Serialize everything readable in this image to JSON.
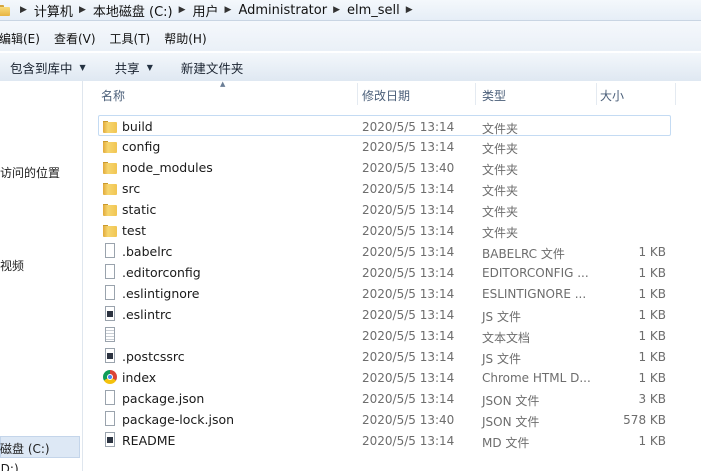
{
  "address": {
    "crumbs": [
      "计算机",
      "本地磁盘 (C:)",
      "用户",
      "Administrator",
      "elm_sell"
    ]
  },
  "menu": {
    "items": [
      "编辑(E)",
      "查看(V)",
      "工具(T)",
      "帮助(H)"
    ]
  },
  "toolbar": {
    "include_library": "包含到库中",
    "share": "共享",
    "new_folder": "新建文件夹"
  },
  "nav": {
    "items": [
      "访问的位置",
      "视频",
      "磁盘 (C:)",
      "(D:)"
    ]
  },
  "columns": {
    "name": "名称",
    "date": "修改日期",
    "type": "类型",
    "size": "大小"
  },
  "files": [
    {
      "name": "build",
      "date": "2020/5/5 13:14",
      "type": "文件夹",
      "size": "",
      "icon": "folder-icon"
    },
    {
      "name": "config",
      "date": "2020/5/5 13:14",
      "type": "文件夹",
      "size": "",
      "icon": "folder-icon"
    },
    {
      "name": "node_modules",
      "date": "2020/5/5 13:40",
      "type": "文件夹",
      "size": "",
      "icon": "folder-icon"
    },
    {
      "name": "src",
      "date": "2020/5/5 13:14",
      "type": "文件夹",
      "size": "",
      "icon": "folder-icon"
    },
    {
      "name": "static",
      "date": "2020/5/5 13:14",
      "type": "文件夹",
      "size": "",
      "icon": "folder-icon"
    },
    {
      "name": "test",
      "date": "2020/5/5 13:14",
      "type": "文件夹",
      "size": "",
      "icon": "folder-icon"
    },
    {
      "name": ".babelrc",
      "date": "2020/5/5 13:14",
      "type": "BABELRC 文件",
      "size": "1 KB",
      "icon": "document-icon"
    },
    {
      "name": ".editorconfig",
      "date": "2020/5/5 13:14",
      "type": "EDITORCONFIG ...",
      "size": "1 KB",
      "icon": "document-icon"
    },
    {
      "name": ".eslintignore",
      "date": "2020/5/5 13:14",
      "type": "ESLINTIGNORE ...",
      "size": "1 KB",
      "icon": "document-icon"
    },
    {
      "name": ".eslintrc",
      "date": "2020/5/5 13:14",
      "type": "JS 文件",
      "size": "1 KB",
      "icon": "js-file-icon"
    },
    {
      "name": "",
      "date": "2020/5/5 13:14",
      "type": "文本文档",
      "size": "1 KB",
      "icon": "text-file-icon"
    },
    {
      "name": ".postcssrc",
      "date": "2020/5/5 13:14",
      "type": "JS 文件",
      "size": "1 KB",
      "icon": "js-file-icon"
    },
    {
      "name": "index",
      "date": "2020/5/5 13:14",
      "type": "Chrome HTML D...",
      "size": "1 KB",
      "icon": "chrome-icon"
    },
    {
      "name": "package.json",
      "date": "2020/5/5 13:14",
      "type": "JSON 文件",
      "size": "3 KB",
      "icon": "document-icon"
    },
    {
      "name": "package-lock.json",
      "date": "2020/5/5 13:40",
      "type": "JSON 文件",
      "size": "578 KB",
      "icon": "document-icon"
    },
    {
      "name": "README",
      "date": "2020/5/5 13:14",
      "type": "MD 文件",
      "size": "1 KB",
      "icon": "js-file-icon"
    }
  ]
}
